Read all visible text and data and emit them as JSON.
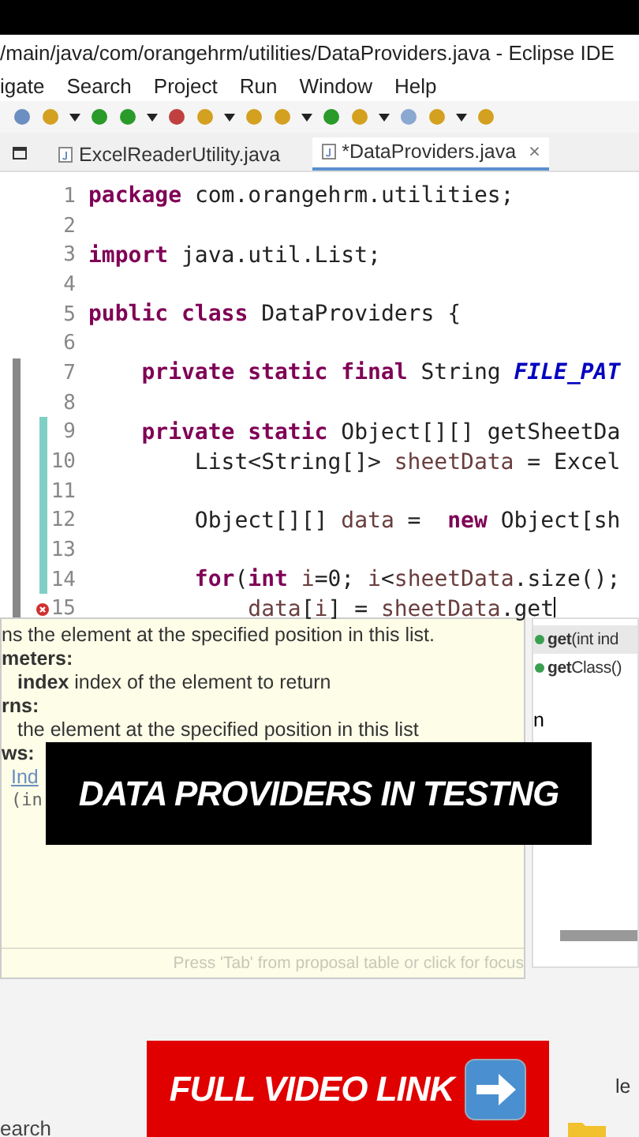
{
  "window": {
    "title": "/main/java/com/orangehrm/utilities/DataProviders.java - Eclipse IDE"
  },
  "menu": [
    "igate",
    "Search",
    "Project",
    "Run",
    "Window",
    "Help"
  ],
  "tabs": [
    {
      "label": "ExcelReaderUtility.java",
      "selected": false
    },
    {
      "label": "*DataProviders.java",
      "selected": true,
      "close": "×"
    }
  ],
  "editor": {
    "lines": [
      {
        "number": "1",
        "tokens": [
          {
            "kind": "kw",
            "text": "package"
          },
          {
            "kind": "plain",
            "text": " com.orangehrm.utilities;"
          }
        ]
      },
      {
        "number": "2"
      },
      {
        "number": "3",
        "tokens": [
          {
            "kind": "kw",
            "text": "import"
          },
          {
            "kind": "plain",
            "text": " java.util.List;"
          }
        ]
      },
      {
        "number": "4"
      },
      {
        "number": "5",
        "tokens": [
          {
            "kind": "kw",
            "text": "public class"
          },
          {
            "kind": "plain",
            "text": " DataProviders {"
          }
        ]
      },
      {
        "number": "6"
      },
      {
        "number": "7",
        "tokens": [
          {
            "kind": "kw",
            "text": "    private static final"
          },
          {
            "kind": "plain",
            "text": " String "
          },
          {
            "kind": "const",
            "text": "FILE_PAT"
          }
        ]
      },
      {
        "number": "8"
      },
      {
        "number": "9",
        "tokens": [
          {
            "kind": "kw",
            "text": "    private static"
          },
          {
            "kind": "plain",
            "text": " Object[][] getSheetDa"
          }
        ]
      },
      {
        "number": "10",
        "tokens": [
          {
            "kind": "plain",
            "text": "        List<String[]> "
          },
          {
            "kind": "var",
            "text": "sheetData"
          },
          {
            "kind": "plain",
            "text": " = Excel"
          }
        ]
      },
      {
        "number": "11"
      },
      {
        "number": "12",
        "tokens": [
          {
            "kind": "plain",
            "text": "        Object[][] "
          },
          {
            "kind": "var",
            "text": "data"
          },
          {
            "kind": "plain",
            "text": " =  "
          },
          {
            "kind": "kw",
            "text": "new"
          },
          {
            "kind": "plain",
            "text": " Object[sh"
          }
        ]
      },
      {
        "number": "13"
      },
      {
        "number": "14",
        "tokens": [
          {
            "kind": "kw",
            "text": "        for"
          },
          {
            "kind": "plain",
            "text": "("
          },
          {
            "kind": "kw",
            "text": "int "
          },
          {
            "kind": "var",
            "text": "i"
          },
          {
            "kind": "plain",
            "text": "=0; "
          },
          {
            "kind": "var",
            "text": "i"
          },
          {
            "kind": "plain",
            "text": "<"
          },
          {
            "kind": "var",
            "text": "sheetData"
          },
          {
            "kind": "plain",
            "text": ".size();"
          }
        ]
      },
      {
        "number": "15",
        "error": true,
        "cursor": true,
        "tokens": [
          {
            "kind": "var",
            "text": "            data"
          },
          {
            "kind": "plain",
            "text": "["
          },
          {
            "kind": "var",
            "text": "i"
          },
          {
            "kind": "plain",
            "text": "] = "
          },
          {
            "kind": "var",
            "text": "sheetData"
          },
          {
            "kind": "plain",
            "text": ".get"
          }
        ]
      }
    ]
  },
  "javadoc": {
    "lines": [
      {
        "kind": "text",
        "text": "ns the element at the specified position in this list."
      },
      {
        "kind": "heading",
        "text": "meters:"
      },
      {
        "kind": "item",
        "text": "**index** index of the element to return"
      },
      {
        "kind": "heading",
        "text": "rns:"
      },
      {
        "kind": "item",
        "text": "the element at the specified position in this list"
      },
      {
        "kind": "heading",
        "text": "ws:"
      },
      {
        "kind": "link",
        "text": "Ind"
      },
      {
        "kind": "code",
        "text": "(in"
      }
    ],
    "footer": "Press 'Tab' from proposal table or click for focus"
  },
  "proposals": {
    "items": [
      {
        "label": "**get**(int ind",
        "selected": true
      },
      {
        "label": "**get**Class()",
        "selected": false
      }
    ],
    "fragment": "n"
  },
  "bottom": {
    "fragment": "le",
    "search": "earch"
  },
  "overlays": {
    "title": "DATA PROVIDERS IN TESTNG",
    "link": "FULL VIDEO LINK"
  }
}
